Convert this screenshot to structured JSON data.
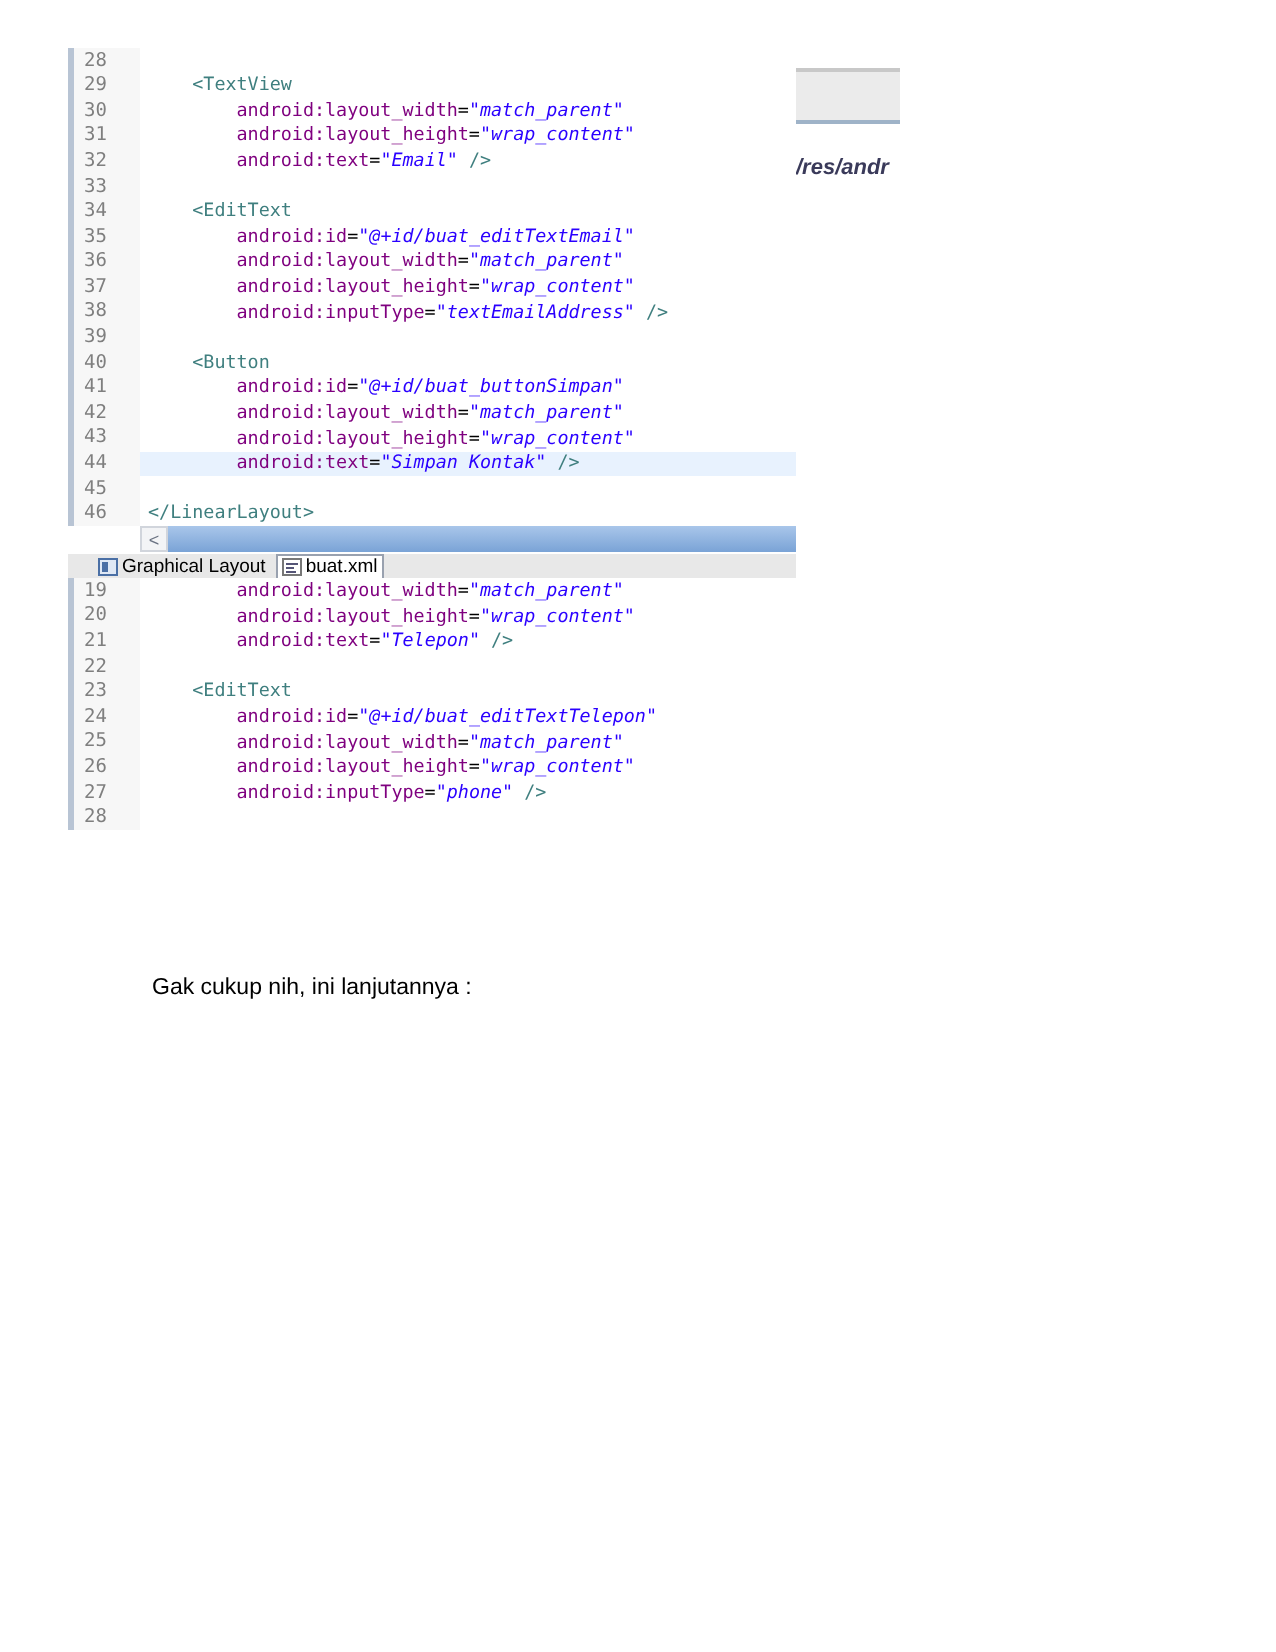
{
  "editor_top": {
    "lines": [
      {
        "number": "28",
        "current": false
      },
      {
        "number": "29",
        "current": false,
        "parts": [
          {
            "kind": "tag",
            "text": "    <TextView"
          }
        ]
      },
      {
        "number": "30",
        "current": false,
        "parts": [
          {
            "kind": "attr",
            "text": "        android:layout_width"
          },
          {
            "kind": "plain",
            "text": "="
          },
          {
            "kind": "value",
            "text": "\"match_parent\""
          }
        ]
      },
      {
        "number": "31",
        "current": false,
        "parts": [
          {
            "kind": "attr",
            "text": "        android:layout_height"
          },
          {
            "kind": "plain",
            "text": "="
          },
          {
            "kind": "value",
            "text": "\"wrap_content\""
          }
        ]
      },
      {
        "number": "32",
        "current": false,
        "parts": [
          {
            "kind": "attr",
            "text": "        android:text"
          },
          {
            "kind": "plain",
            "text": "="
          },
          {
            "kind": "value",
            "text": "\"Email\""
          },
          {
            "kind": "tag",
            "text": " />"
          }
        ]
      },
      {
        "number": "33",
        "current": false
      },
      {
        "number": "34",
        "current": false,
        "parts": [
          {
            "kind": "tag",
            "text": "    <EditText"
          }
        ]
      },
      {
        "number": "35",
        "current": false,
        "parts": [
          {
            "kind": "attr",
            "text": "        android:id"
          },
          {
            "kind": "plain",
            "text": "="
          },
          {
            "kind": "value",
            "text": "\"@+id/buat_editTextEmail\""
          }
        ]
      },
      {
        "number": "36",
        "current": false,
        "parts": [
          {
            "kind": "attr",
            "text": "        android:layout_width"
          },
          {
            "kind": "plain",
            "text": "="
          },
          {
            "kind": "value",
            "text": "\"match_parent\""
          }
        ]
      },
      {
        "number": "37",
        "current": false,
        "parts": [
          {
            "kind": "attr",
            "text": "        android:layout_height"
          },
          {
            "kind": "plain",
            "text": "="
          },
          {
            "kind": "value",
            "text": "\"wrap_content\""
          }
        ]
      },
      {
        "number": "38",
        "current": false,
        "parts": [
          {
            "kind": "attr",
            "text": "        android:inputType"
          },
          {
            "kind": "plain",
            "text": "="
          },
          {
            "kind": "value",
            "text": "\"textEmailAddress\""
          },
          {
            "kind": "tag",
            "text": " />"
          }
        ]
      },
      {
        "number": "39",
        "current": false
      },
      {
        "number": "40",
        "current": false,
        "parts": [
          {
            "kind": "tag",
            "text": "    <Button"
          }
        ]
      },
      {
        "number": "41",
        "current": false,
        "parts": [
          {
            "kind": "attr",
            "text": "        android:id"
          },
          {
            "kind": "plain",
            "text": "="
          },
          {
            "kind": "value",
            "text": "\"@+id/buat_buttonSimpan\""
          }
        ]
      },
      {
        "number": "42",
        "current": false,
        "parts": [
          {
            "kind": "attr",
            "text": "        android:layout_width"
          },
          {
            "kind": "plain",
            "text": "="
          },
          {
            "kind": "value",
            "text": "\"match_parent\""
          }
        ]
      },
      {
        "number": "43",
        "current": false,
        "parts": [
          {
            "kind": "attr",
            "text": "        android:layout_height"
          },
          {
            "kind": "plain",
            "text": "="
          },
          {
            "kind": "value",
            "text": "\"wrap_content\""
          }
        ]
      },
      {
        "number": "44",
        "current": true,
        "parts": [
          {
            "kind": "attr",
            "text": "        android:text"
          },
          {
            "kind": "plain",
            "text": "="
          },
          {
            "kind": "value",
            "text": "\"Simpan Kontak\""
          },
          {
            "kind": "tag",
            "text": " />"
          }
        ]
      },
      {
        "number": "45",
        "current": false
      },
      {
        "number": "46",
        "current": false,
        "parts": [
          {
            "kind": "tag",
            "text": "</LinearLayout>"
          }
        ]
      }
    ]
  },
  "scroll_button": "<",
  "tabs": [
    {
      "label": "Graphical Layout",
      "kind": "layout",
      "selected": false
    },
    {
      "label": "buat.xml",
      "kind": "xml",
      "selected": true
    }
  ],
  "side_path": "/res/andr",
  "editor_bottom": {
    "lines": [
      {
        "number": "19",
        "current": false,
        "parts": [
          {
            "kind": "attr",
            "text": "        android:layout_width"
          },
          {
            "kind": "plain",
            "text": "="
          },
          {
            "kind": "value",
            "text": "\"match_parent\""
          }
        ]
      },
      {
        "number": "20",
        "current": false,
        "parts": [
          {
            "kind": "attr",
            "text": "        android:layout_height"
          },
          {
            "kind": "plain",
            "text": "="
          },
          {
            "kind": "value",
            "text": "\"wrap_content\""
          }
        ]
      },
      {
        "number": "21",
        "current": false,
        "parts": [
          {
            "kind": "attr",
            "text": "        android:text"
          },
          {
            "kind": "plain",
            "text": "="
          },
          {
            "kind": "value",
            "text": "\"Telepon\""
          },
          {
            "kind": "tag",
            "text": " />"
          }
        ]
      },
      {
        "number": "22",
        "current": false
      },
      {
        "number": "23",
        "current": false,
        "parts": [
          {
            "kind": "tag",
            "text": "    <EditText"
          }
        ]
      },
      {
        "number": "24",
        "current": false,
        "parts": [
          {
            "kind": "attr",
            "text": "        android:id"
          },
          {
            "kind": "plain",
            "text": "="
          },
          {
            "kind": "value",
            "text": "\"@+id/buat_editTextTelepon\""
          }
        ]
      },
      {
        "number": "25",
        "current": false,
        "parts": [
          {
            "kind": "attr",
            "text": "        android:layout_width"
          },
          {
            "kind": "plain",
            "text": "="
          },
          {
            "kind": "value",
            "text": "\"match_parent\""
          }
        ]
      },
      {
        "number": "26",
        "current": false,
        "parts": [
          {
            "kind": "attr",
            "text": "        android:layout_height"
          },
          {
            "kind": "plain",
            "text": "="
          },
          {
            "kind": "value",
            "text": "\"wrap_content\""
          }
        ]
      },
      {
        "number": "27",
        "current": false,
        "parts": [
          {
            "kind": "attr",
            "text": "        android:inputType"
          },
          {
            "kind": "plain",
            "text": "="
          },
          {
            "kind": "value",
            "text": "\"phone\""
          },
          {
            "kind": "tag",
            "text": " />"
          }
        ]
      },
      {
        "number": "28",
        "current": false
      }
    ]
  },
  "caption": "Gak cukup nih, ini lanjutannya :"
}
